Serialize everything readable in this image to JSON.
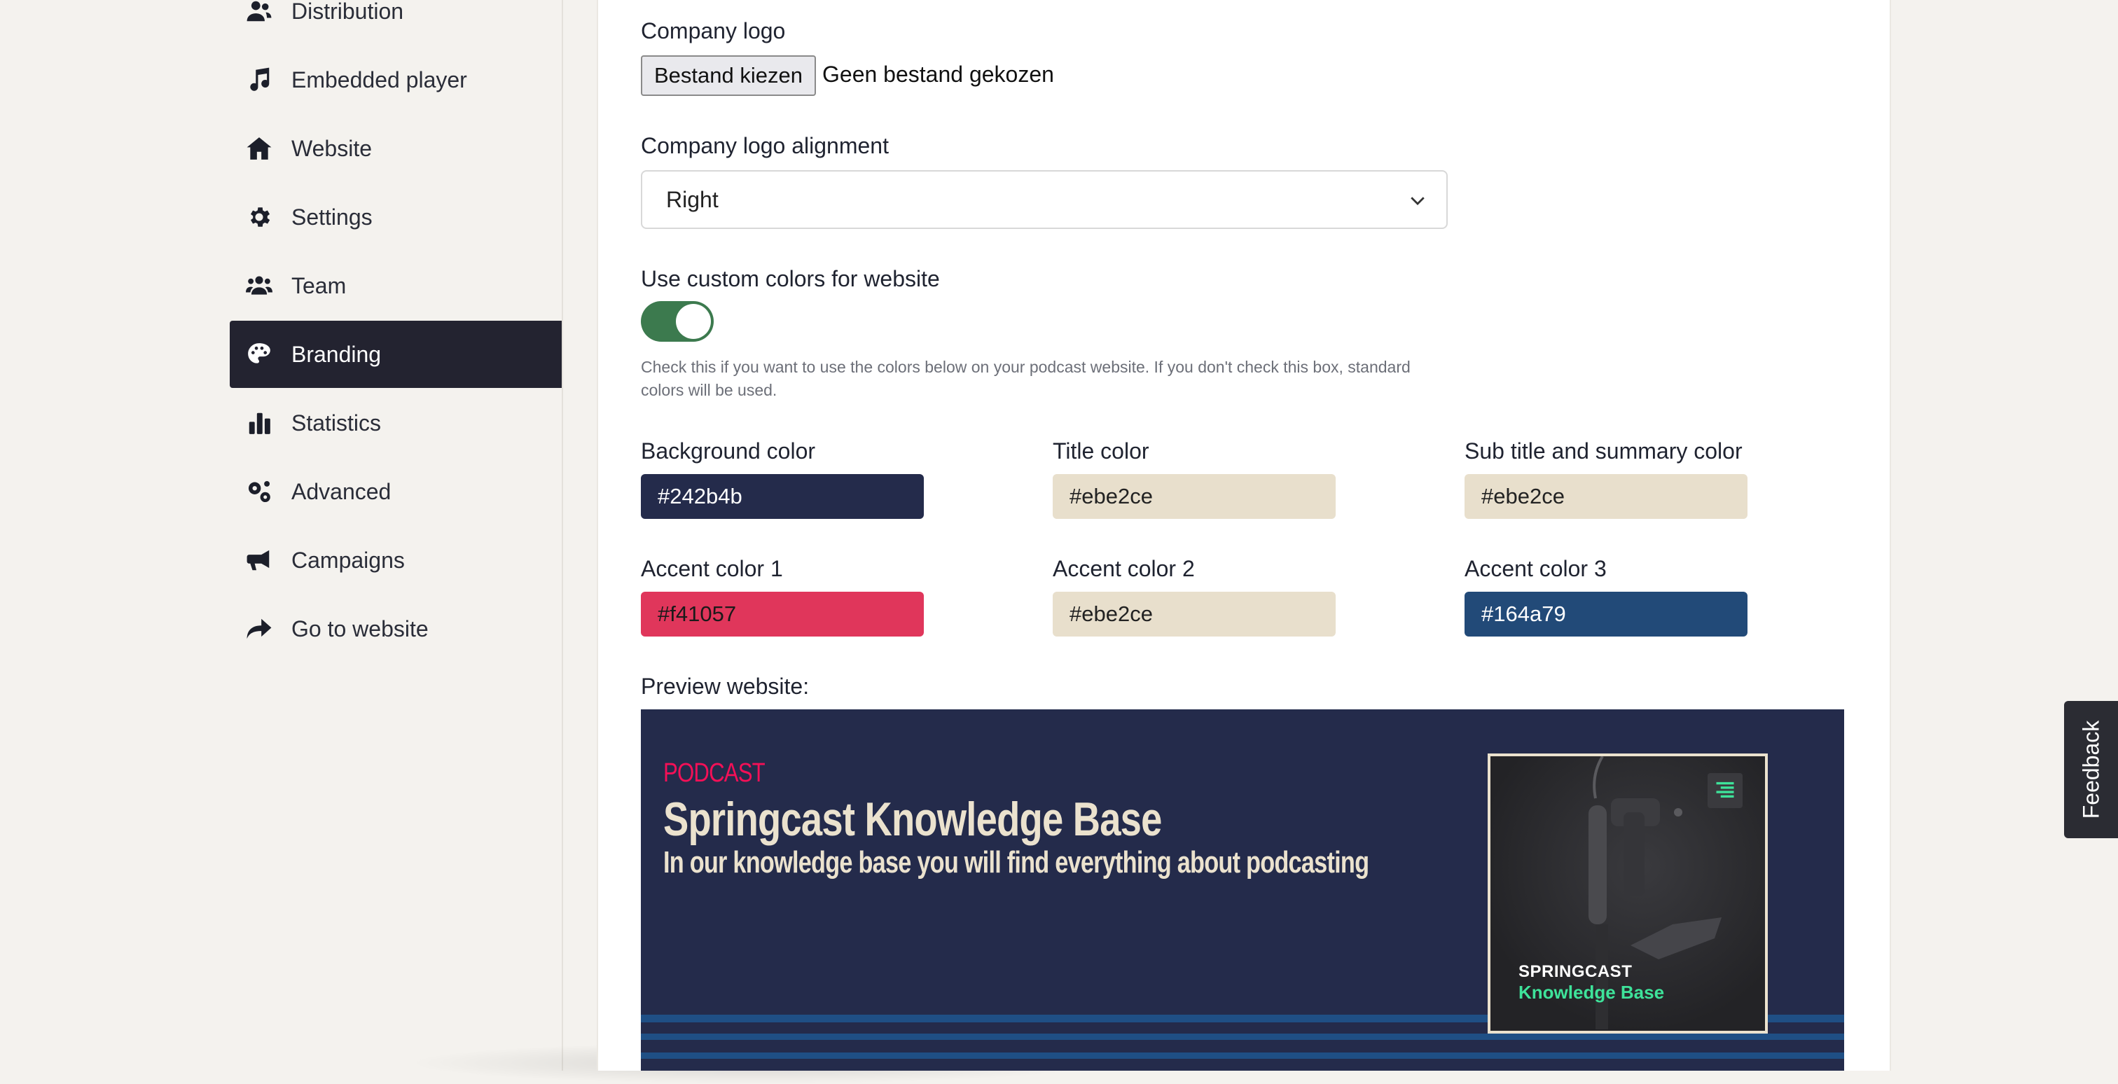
{
  "sidebar": {
    "items": [
      {
        "label": "Distribution",
        "icon": "users-icon"
      },
      {
        "label": "Embedded player",
        "icon": "music-note-icon"
      },
      {
        "label": "Website",
        "icon": "home-icon"
      },
      {
        "label": "Settings",
        "icon": "gear-icon"
      },
      {
        "label": "Team",
        "icon": "team-icon"
      },
      {
        "label": "Branding",
        "icon": "palette-icon",
        "active": true
      },
      {
        "label": "Statistics",
        "icon": "bar-chart-icon"
      },
      {
        "label": "Advanced",
        "icon": "gears-icon"
      },
      {
        "label": "Campaigns",
        "icon": "megaphone-icon"
      },
      {
        "label": "Go to website",
        "icon": "share-arrow-icon"
      }
    ]
  },
  "form": {
    "company_logo_label": "Company logo",
    "file_button_label": "Bestand kiezen",
    "file_status": "Geen bestand gekozen",
    "alignment_label": "Company logo alignment",
    "alignment_value": "Right",
    "custom_colors_label": "Use custom colors for website",
    "custom_colors_enabled": true,
    "custom_colors_help": "Check this if you want to use the colors below on your podcast website. If you don't check this box, standard colors will be used.",
    "colors": {
      "background": {
        "label": "Background color",
        "value": "#242b4b"
      },
      "title": {
        "label": "Title color",
        "value": "#ebe2ce"
      },
      "subtitle": {
        "label": "Sub title and summary color",
        "value": "#ebe2ce"
      },
      "accent1": {
        "label": "Accent color 1",
        "value": "#f41057"
      },
      "accent2": {
        "label": "Accent color 2",
        "value": "#ebe2ce"
      },
      "accent3": {
        "label": "Accent color 3",
        "value": "#164a79"
      }
    },
    "preview_label": "Preview website:"
  },
  "preview": {
    "kicker": "PODCAST",
    "title": "Springcast Knowledge Base",
    "subtitle": "In our knowledge base you will find everything about podcasting",
    "cover_line1": "SPRINGCAST",
    "cover_line2": "Knowledge Base"
  },
  "feedback_label": "Feedback"
}
